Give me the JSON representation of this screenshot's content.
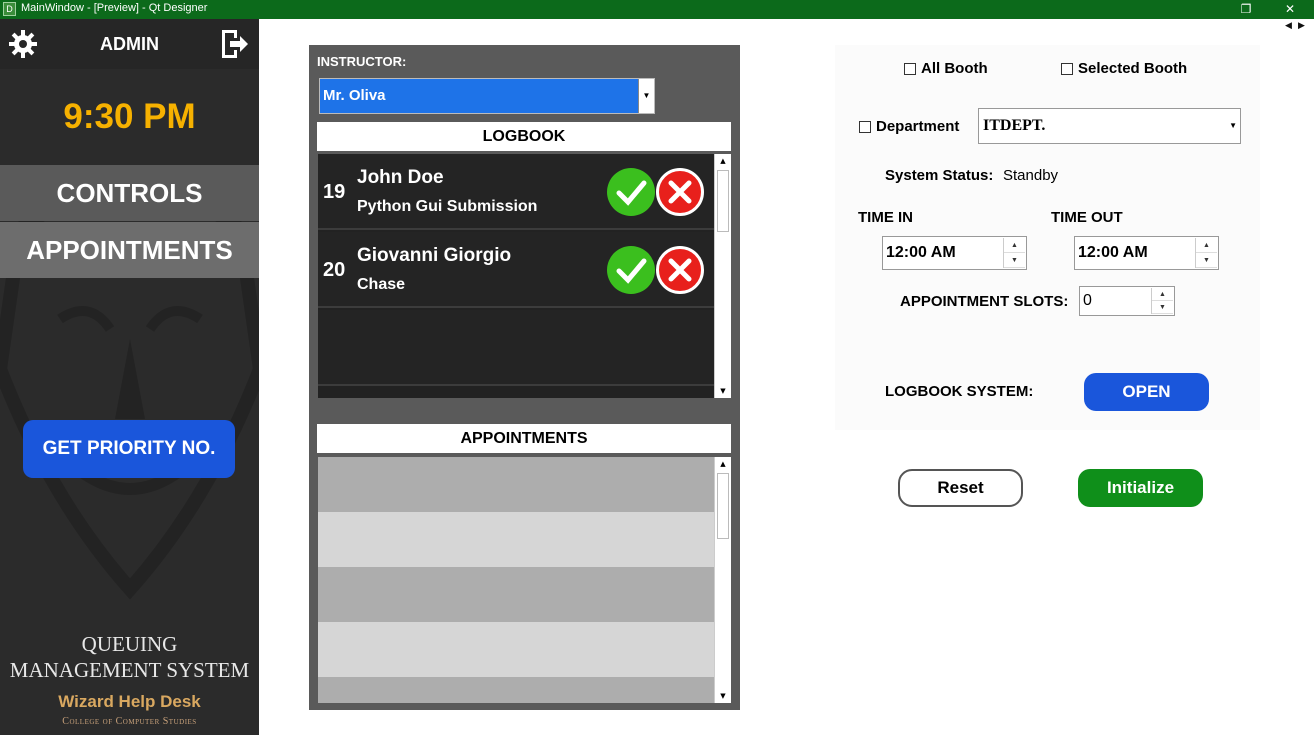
{
  "window": {
    "title": "MainWindow - [Preview] - Qt Designer",
    "app_icon": "D"
  },
  "sidebar": {
    "admin_label": "ADMIN",
    "time": "9:30 PM",
    "nav": {
      "controls": "CONTROLS",
      "appointments": "APPOINTMENTS"
    },
    "priority_button": "GET PRIORITY NO.",
    "brand_line1": "QUEUING",
    "brand_line2": "MANAGEMENT SYSTEM",
    "brand_sub": "Wizard Help Desk",
    "brand_college": "College of Computer Studies",
    "accent_color": "#f6b100"
  },
  "center": {
    "instructor_label": "INSTRUCTOR:",
    "instructor_selected": "Mr. Oliva",
    "logbook_header": "LOGBOOK",
    "logbook": [
      {
        "number": "19",
        "name": "John Doe",
        "detail": "Python Gui Submission"
      },
      {
        "number": "20",
        "name": "Giovanni Giorgio",
        "detail": "Chase"
      }
    ],
    "appointments_header": "APPOINTMENTS"
  },
  "settings": {
    "all_booth": "All Booth",
    "selected_booth": "Selected Booth",
    "department_label": "Department",
    "department_value": "ITDEPT.",
    "system_status_label": "System Status:",
    "system_status_value": "Standby",
    "time_in_label": "TIME IN",
    "time_out_label": "TIME OUT",
    "time_in_value": "12:00 AM",
    "time_out_value": "12:00 AM",
    "appointment_slots_label": "APPOINTMENT SLOTS:",
    "appointment_slots_value": "0",
    "logbook_system_label": "LOGBOOK SYSTEM:",
    "logbook_system_button": "OPEN",
    "reset_button": "Reset",
    "initialize_button": "Initialize"
  },
  "icons": {
    "settings": "gear-icon",
    "logout": "logout-icon",
    "accept": "check-icon",
    "reject": "x-icon"
  }
}
